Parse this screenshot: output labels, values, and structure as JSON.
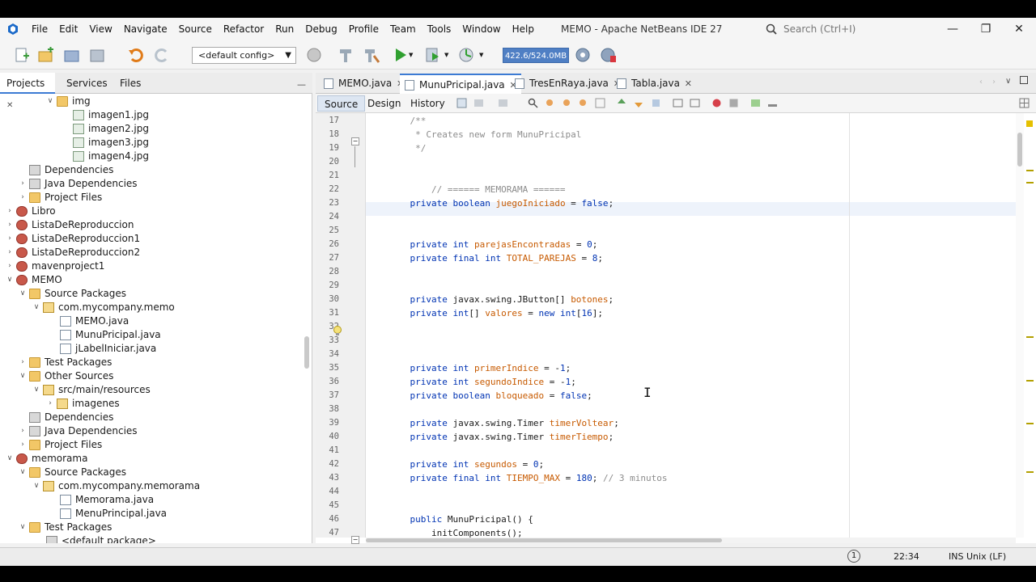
{
  "window": {
    "title": "MEMO - Apache NetBeans IDE 27",
    "search_placeholder": "Search (Ctrl+I)"
  },
  "menu": [
    "File",
    "Edit",
    "View",
    "Navigate",
    "Source",
    "Refactor",
    "Run",
    "Debug",
    "Profile",
    "Team",
    "Tools",
    "Window",
    "Help"
  ],
  "toolbar": {
    "config": "<default config>",
    "memory": "422.6/524.0MB"
  },
  "left_panel": {
    "tabs": [
      "Projects",
      "Services",
      "Files"
    ],
    "tree": [
      {
        "label": "img",
        "icon": "folder-icon",
        "expanded": true
      },
      {
        "label": "imagen1.jpg",
        "icon": "image-file-icon"
      },
      {
        "label": "imagen2.jpg",
        "icon": "image-file-icon"
      },
      {
        "label": "imagen3.jpg",
        "icon": "image-file-icon"
      },
      {
        "label": "imagen4.jpg",
        "icon": "image-file-icon"
      },
      {
        "label": "Dependencies",
        "icon": "library-icon"
      },
      {
        "label": "Java Dependencies",
        "icon": "library-icon"
      },
      {
        "label": "Project Files",
        "icon": "folder-icon"
      },
      {
        "label": "Libro",
        "icon": "project-icon"
      },
      {
        "label": "ListaDeReproduccion",
        "icon": "project-icon"
      },
      {
        "label": "ListaDeReproduccion1",
        "icon": "project-icon"
      },
      {
        "label": "ListaDeReproduccion2",
        "icon": "project-icon"
      },
      {
        "label": "mavenproject1",
        "icon": "project-icon"
      },
      {
        "label": "MEMO",
        "icon": "project-icon"
      },
      {
        "label": "Source Packages",
        "icon": "folder-icon"
      },
      {
        "label": "com.mycompany.memo",
        "icon": "package-icon"
      },
      {
        "label": "MEMO.java",
        "icon": "java-file-icon"
      },
      {
        "label": "MunuPricipal.java",
        "icon": "java-form-icon"
      },
      {
        "label": "jLabelIniciar.java",
        "icon": "java-file-icon"
      },
      {
        "label": "Test Packages",
        "icon": "folder-icon"
      },
      {
        "label": "Other Sources",
        "icon": "folder-icon"
      },
      {
        "label": "src/main/resources",
        "icon": "package-icon"
      },
      {
        "label": "imagenes",
        "icon": "package-icon"
      },
      {
        "label": "Dependencies",
        "icon": "library-icon"
      },
      {
        "label": "Java Dependencies",
        "icon": "library-icon"
      },
      {
        "label": "Project Files",
        "icon": "folder-icon"
      },
      {
        "label": "memorama",
        "icon": "project-icon"
      },
      {
        "label": "Source Packages",
        "icon": "folder-icon"
      },
      {
        "label": "com.mycompany.memorama",
        "icon": "package-icon"
      },
      {
        "label": "Memorama.java",
        "icon": "java-file-icon"
      },
      {
        "label": "MenuPrincipal.java",
        "icon": "java-form-icon"
      },
      {
        "label": "Test Packages",
        "icon": "folder-icon"
      },
      {
        "label": "<default package>",
        "icon": "package-icon"
      }
    ]
  },
  "editor": {
    "tabs": [
      "MEMO.java",
      "MunuPricipal.java",
      "TresEnRaya.java",
      "Tabla.java"
    ],
    "view_tabs": [
      "Source",
      "Design",
      "History"
    ],
    "lines": [
      {
        "n": "17",
        "text": "    /**"
      },
      {
        "n": "18",
        "text": "     * Creates new form MunuPricipal"
      },
      {
        "n": "19",
        "text": "     */"
      },
      {
        "n": "20",
        "text": ""
      },
      {
        "n": "21",
        "text": ""
      },
      {
        "n": "22",
        "text": "        // ====== MEMORAMA ======"
      },
      {
        "n": "23",
        "text": "    private boolean juegoIniciado = false;"
      },
      {
        "n": "24",
        "text": ""
      },
      {
        "n": "25",
        "text": ""
      },
      {
        "n": "26",
        "text": "    private int parejasEncontradas = 0;"
      },
      {
        "n": "27",
        "text": "    private final int TOTAL_PAREJAS = 8;"
      },
      {
        "n": "28",
        "text": ""
      },
      {
        "n": "29",
        "text": ""
      },
      {
        "n": "30",
        "text": "    private javax.swing.JButton[] botones;"
      },
      {
        "n": "31",
        "text": "    private int[] valores = new int[16];"
      },
      {
        "n": "32",
        "text": ""
      },
      {
        "n": "33",
        "text": ""
      },
      {
        "n": "34",
        "text": ""
      },
      {
        "n": "35",
        "text": "    private int primerIndice = -1;"
      },
      {
        "n": "36",
        "text": "    private int segundoIndice = -1;"
      },
      {
        "n": "37",
        "text": "    private boolean bloqueado = false;"
      },
      {
        "n": "38",
        "text": ""
      },
      {
        "n": "39",
        "text": "    private javax.swing.Timer timerVoltear;"
      },
      {
        "n": "40",
        "text": "    private javax.swing.Timer timerTiempo;"
      },
      {
        "n": "41",
        "text": ""
      },
      {
        "n": "42",
        "text": "    private int segundos = 0;"
      },
      {
        "n": "43",
        "text": "    private final int TIEMPO_MAX = 180; // 3 minutos"
      },
      {
        "n": "44",
        "text": ""
      },
      {
        "n": "45",
        "text": ""
      },
      {
        "n": "46",
        "text": "    public MunuPricipal() {"
      },
      {
        "n": "47",
        "text": "        initComponents();"
      }
    ]
  },
  "status": {
    "notifications": "1",
    "position": "22:34",
    "mode": "INS",
    "line_ending": "Unix (LF)"
  }
}
